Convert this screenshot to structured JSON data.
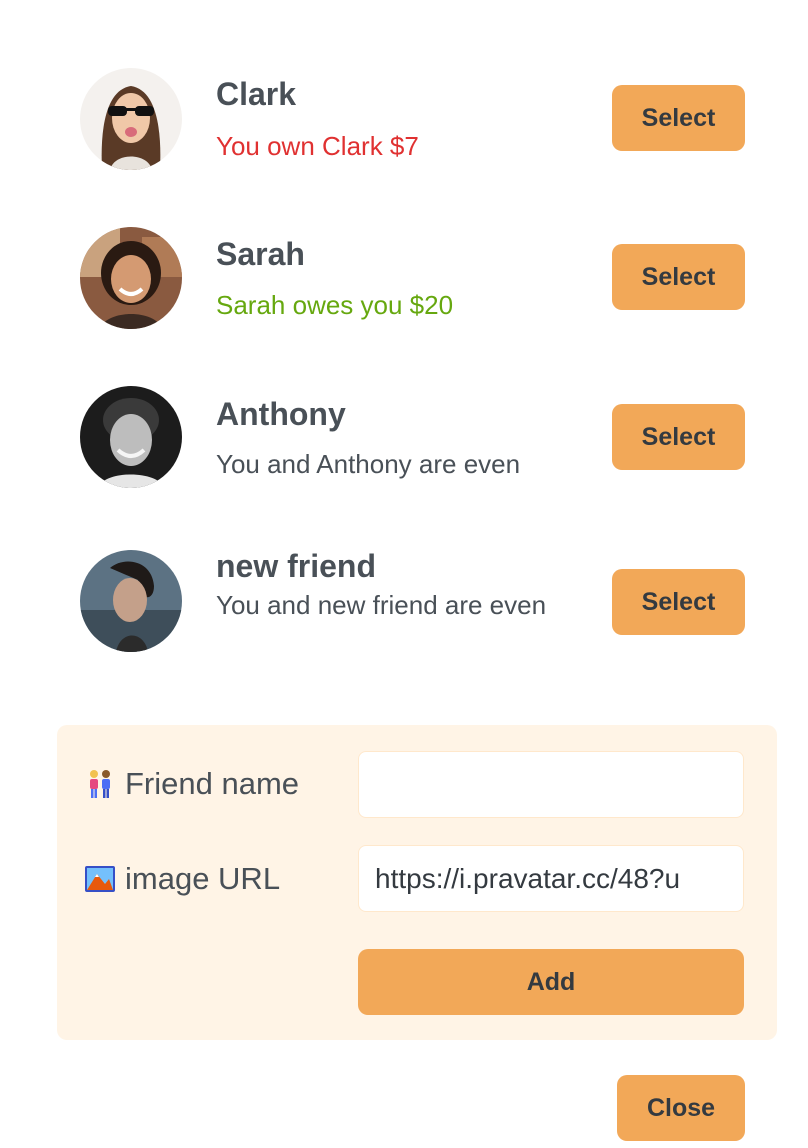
{
  "friends": [
    {
      "name": "Clark",
      "status": "You own Clark $7",
      "status_color": "#e03131",
      "select_label": "Select"
    },
    {
      "name": "Sarah",
      "status": "Sarah owes you $20",
      "status_color": "#66a80f",
      "select_label": "Select"
    },
    {
      "name": "Anthony",
      "status": "You and Anthony are even",
      "status_color": "#495057",
      "select_label": "Select"
    },
    {
      "name": "new friend",
      "status": "You and new friend are even",
      "status_color": "#495057",
      "select_label": "Select"
    }
  ],
  "add_form": {
    "name_label": "Friend name",
    "name_icon": "two-people-icon",
    "name_value": "",
    "image_label": "image URL",
    "image_icon": "picture-icon",
    "image_value": "https://i.pravatar.cc/48?u",
    "add_label": "Add"
  },
  "close_label": "Close",
  "colors": {
    "accent": "#f2a858",
    "form_background": "#fff4e6",
    "owe_red": "#e03131",
    "owed_green": "#66a80f",
    "text": "#495057"
  }
}
